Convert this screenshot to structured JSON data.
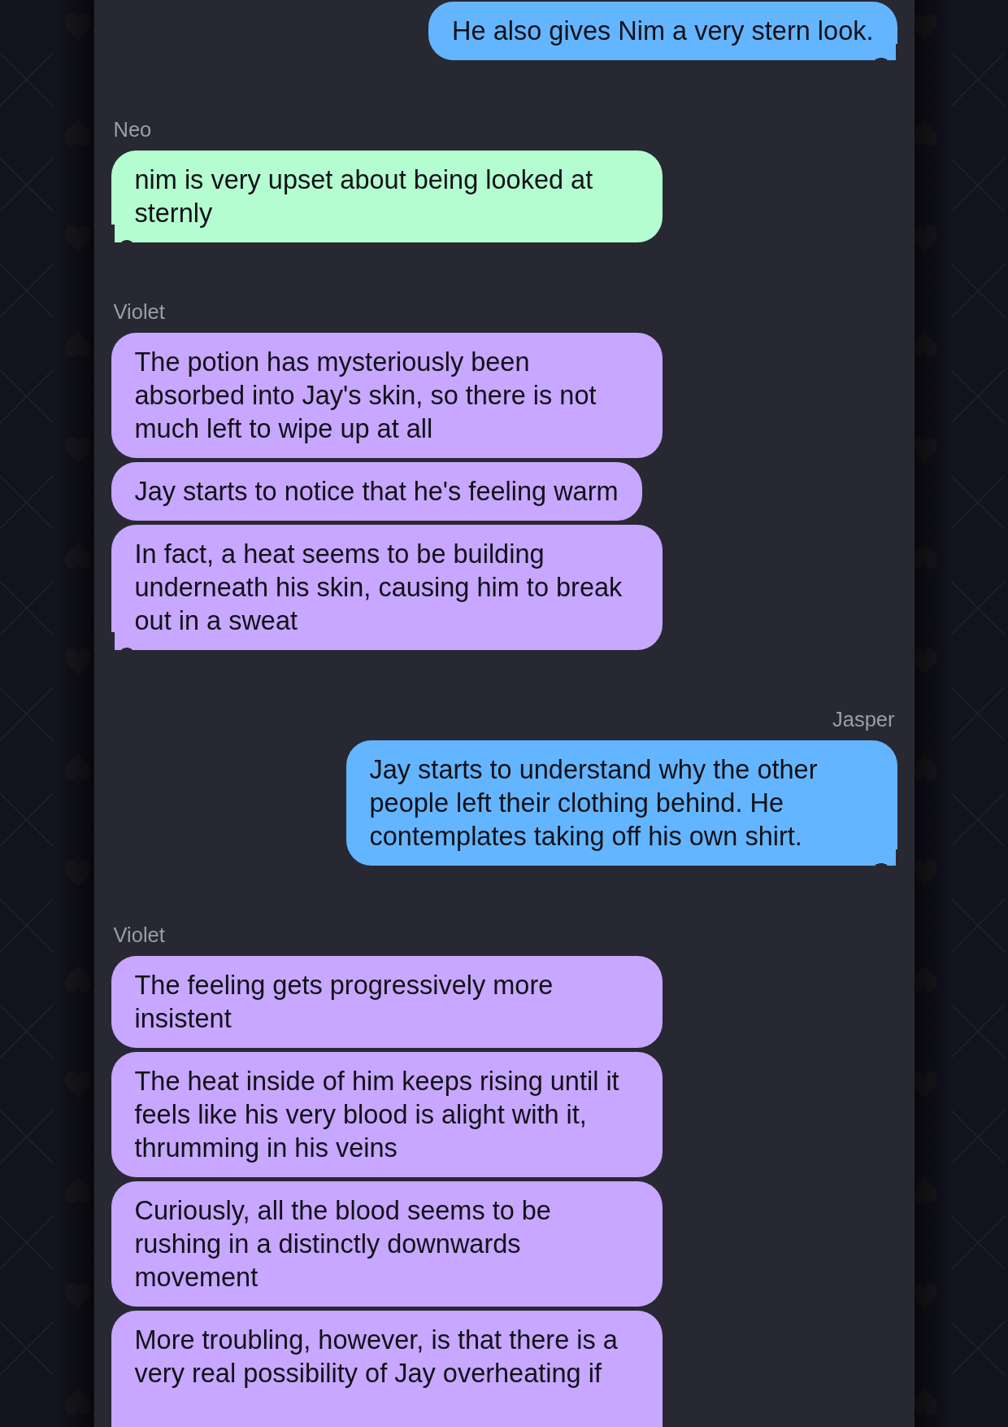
{
  "conversation": {
    "groups": [
      {
        "kind": "outgoing",
        "color": "#64b5ff",
        "messages": [
          "He also gives Nim a very stern look."
        ]
      },
      {
        "kind": "incoming",
        "sender": "Neo",
        "color": "#b4fdd0",
        "messages": [
          "nim is very upset about being looked at sternly"
        ]
      },
      {
        "kind": "incoming",
        "sender": "Violet",
        "color": "#c7a7ff",
        "messages": [
          "The potion has mysteriously been absorbed into Jay's skin, so there is not much left to wipe up at all",
          "Jay starts to notice that he's feeling warm",
          "In fact, a heat seems to be building underneath his skin, causing him to break out in a sweat"
        ]
      },
      {
        "kind": "outgoing",
        "sender": "Jasper",
        "color": "#64b5ff",
        "messages": [
          "Jay starts to understand why the other people left their clothing behind. He contemplates taking off his own shirt."
        ]
      },
      {
        "kind": "incoming",
        "sender": "Violet",
        "color": "#c7a7ff",
        "messages": [
          "The feeling gets progressively more insistent",
          "The heat inside of him keeps rising until it feels like his very blood is alight with it, thrumming in his veins",
          "Curiously, all the blood seems to be rushing in a distinctly downwards movement",
          "More troubling, however, is that there is a very real possibility of Jay overheating if"
        ]
      }
    ]
  }
}
